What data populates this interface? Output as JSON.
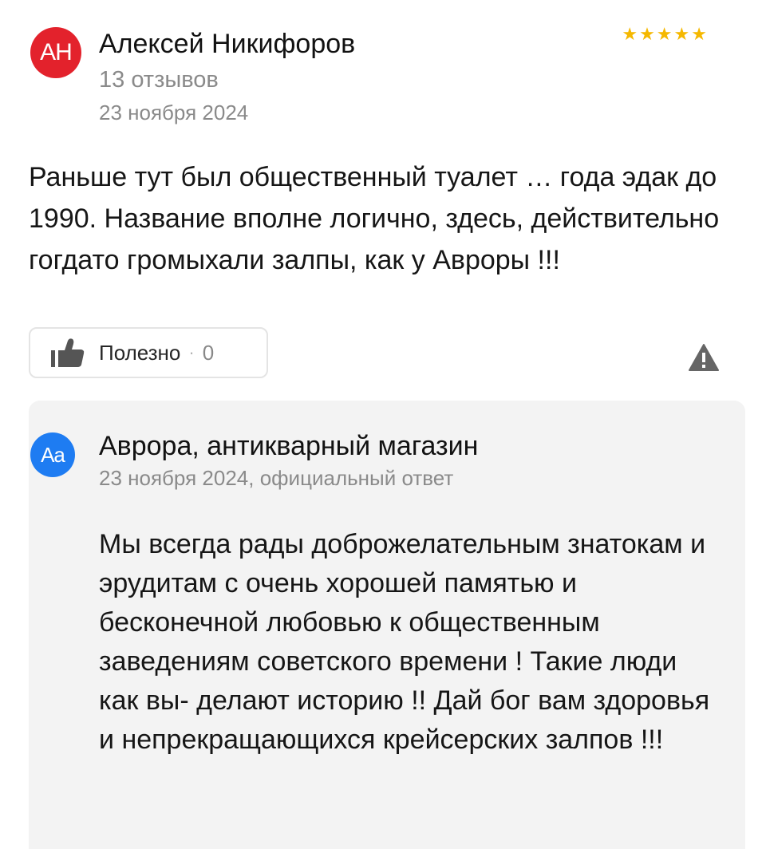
{
  "review": {
    "author_initials": "АН",
    "author_name": "Алексей Никифоров",
    "review_count": "13 отзывов",
    "date": "23 ноября 2024",
    "rating": 5,
    "stars": [
      "★",
      "★",
      "★",
      "★",
      "★"
    ],
    "text": "Раньше тут был общественный туалет … года эдак до 1990. Название вполне логично, здесь, действительно гогдато громыхали залпы, как у Авроры !!!",
    "useful": {
      "label": "Полезно",
      "separator": "·",
      "count": "0"
    },
    "icons": {
      "thumb": "thumbs-up-icon",
      "report": "warning-triangle-icon"
    }
  },
  "answer": {
    "org_initials": "Aa",
    "org_name": "Аврора, антикварный магазин",
    "meta": "23 ноября 2024, официальный ответ",
    "text": "Мы всегда рады доброжелательным знатокам и эрудитам с очень хорошей памятью и бесконечной любовью к общественным заведениям советского времени ! Такие люди как вы- делают историю !! Дай бог вам здоровья и непрекращающихся крейсерских залпов !!!"
  },
  "colors": {
    "author_avatar": "#e3222c",
    "org_avatar": "#1e7cf2",
    "star": "#f5b800",
    "answer_background": "#f3f3f3",
    "muted_text": "#8a8a8a"
  }
}
